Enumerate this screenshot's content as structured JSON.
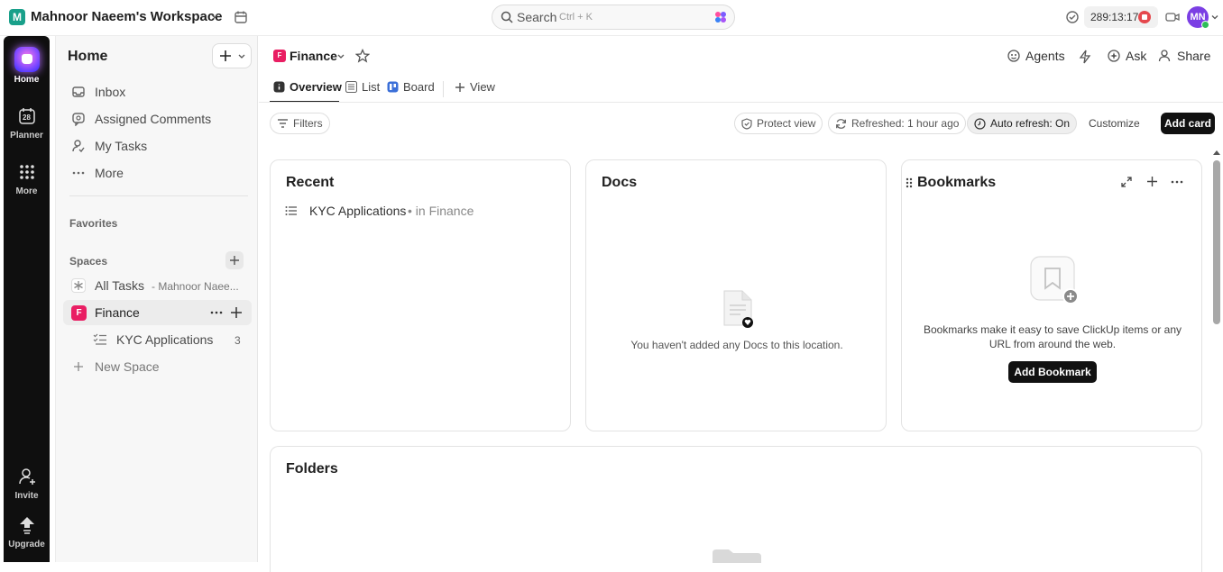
{
  "topbar": {
    "workspace_initial": "M",
    "workspace_name": "Mahnoor Naeem's Workspace",
    "search_label": "Search",
    "search_shortcut": "Ctrl + K",
    "timer_value": "289:13:17",
    "user_initials": "MN"
  },
  "rail": {
    "items": [
      {
        "label": "Home"
      },
      {
        "label": "Planner",
        "icon_text": "28"
      },
      {
        "label": "More"
      },
      {
        "label": "Invite"
      },
      {
        "label": "Upgrade"
      }
    ]
  },
  "sidebar": {
    "title": "Home",
    "nav": [
      {
        "label": "Inbox",
        "icon": "inbox-icon"
      },
      {
        "label": "Assigned Comments",
        "icon": "comment-icon"
      },
      {
        "label": "My Tasks",
        "icon": "user-icon"
      },
      {
        "label": "More",
        "icon": "more-dots-icon"
      }
    ],
    "favorites_label": "Favorites",
    "spaces_label": "Spaces",
    "all_tasks_label": "All Tasks",
    "all_tasks_sub": "- Mahnoor Naee...",
    "space_initial": "F",
    "space_name": "Finance",
    "list_name": "KYC Applications",
    "list_count": "3",
    "new_space_label": "New Space"
  },
  "header": {
    "space_initial": "F",
    "title": "Finance",
    "agents_label": "Agents",
    "ask_label": "Ask",
    "share_label": "Share"
  },
  "tabs": [
    {
      "label": "Overview"
    },
    {
      "label": "List"
    },
    {
      "label": "Board"
    },
    {
      "label": "View"
    }
  ],
  "toolbar": {
    "filters_label": "Filters",
    "protect_label": "Protect view",
    "refreshed_label": "Refreshed: 1 hour ago",
    "auto_refresh_label": "Auto refresh: On",
    "customize_label": "Customize",
    "add_card_label": "Add card"
  },
  "cards": {
    "recent": {
      "title": "Recent",
      "item_label": "KYC Applications",
      "item_location": "• in Finance"
    },
    "docs": {
      "title": "Docs",
      "empty_text": "You haven't added any Docs to this location."
    },
    "bookmarks": {
      "title": "Bookmarks",
      "empty_text": "Bookmarks make it easy to save ClickUp items or any URL from around the web.",
      "button_label": "Add Bookmark"
    },
    "folders": {
      "title": "Folders"
    }
  }
}
